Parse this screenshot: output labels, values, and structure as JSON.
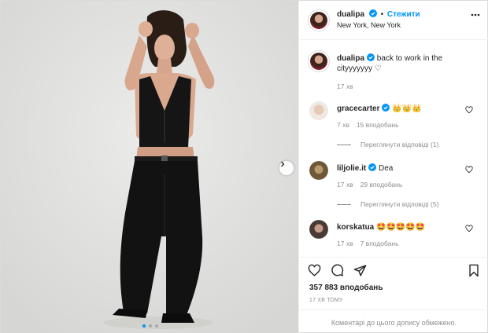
{
  "post": {
    "author": "dualipa",
    "follow_label": "Стежити",
    "location": "New York, New York",
    "dots_count": 3,
    "active_dot": 0
  },
  "caption": {
    "username": "dualipa",
    "text": "back to work in the cityyyyyyy ♡",
    "time": "17 хв"
  },
  "comments": [
    {
      "username": "gracecarter",
      "text": "👑👑👑",
      "time": "7 хв",
      "likes": "15 вподобань",
      "replies": "Переглянути відповіді (1)"
    },
    {
      "username": "liljolie.it",
      "text": "Dea",
      "time": "17 хв",
      "likes": "29 вподобань",
      "replies": "Переглянути відповіді (5)"
    },
    {
      "username": "korskatua",
      "text": "🤩🤩🤩🤩🤩",
      "time": "17 хв",
      "likes": "7 вподобань",
      "replies": ""
    }
  ],
  "actions": {
    "likes": "357 883 вподобань",
    "time_ago": "17 ХВ ТОМУ",
    "comments_limited": "Коментарі до цього допису обмежено."
  },
  "colors": {
    "accent": "#0095f6",
    "muted": "#8e8e8e",
    "text": "#262626",
    "border": "#dbdbdb"
  },
  "icons": {
    "verified": "verified-badge-icon",
    "like": "heart-icon",
    "comment": "comment-icon",
    "share": "paper-plane-icon",
    "save": "bookmark-icon",
    "more": "more-dots-icon",
    "next": "chevron-right-icon"
  }
}
